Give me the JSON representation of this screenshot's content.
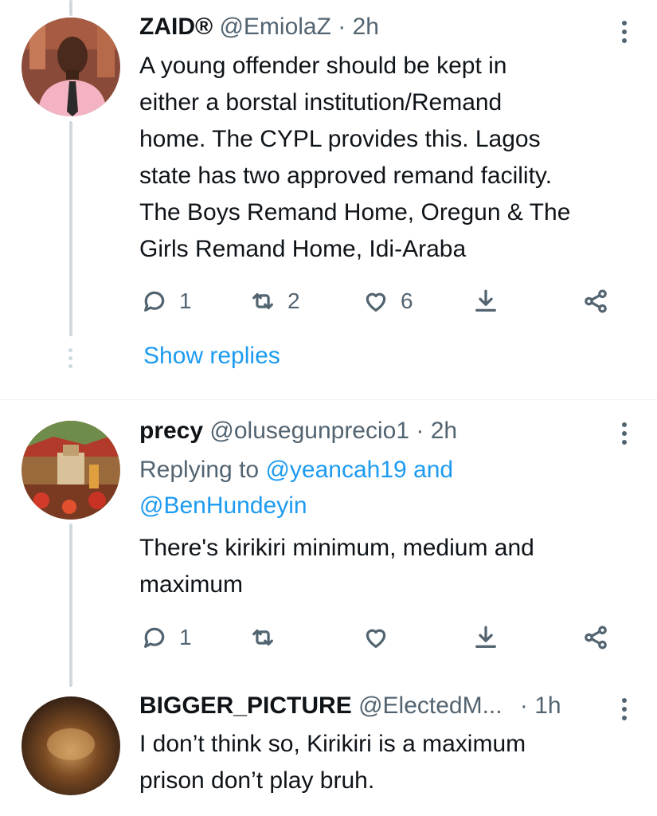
{
  "tweets": [
    {
      "name": "ZAID®",
      "handle": "@EmiolaZ",
      "time": "· 2h",
      "text_lines": [
        "A young offender should be kept in",
        "either a borstal institution/Remand",
        "home. The CYPL provides this. Lagos",
        "state has two approved remand facility.",
        "The Boys Remand Home, Oregun & The",
        "Girls Remand Home, Idi-Araba"
      ],
      "replies": "1",
      "retweets": "2",
      "likes": "6",
      "show_replies": "Show replies",
      "avatar_icon": "person-photo"
    },
    {
      "name": "precy",
      "handle": "@olusegunprecio1",
      "time": "· 2h",
      "replying_prefix": "Replying to",
      "replying_user1": "@yeancah19",
      "replying_and": "and",
      "replying_user2": "@BenHundeyin",
      "text_lines": [
        "There's kirikiri minimum, medium and",
        "maximum"
      ],
      "replies": "1",
      "retweets": "",
      "likes": "",
      "avatar_icon": "garden-photo"
    },
    {
      "name": "BIGGER_PICTURE",
      "handle": "@ElectedM...",
      "time": "· 1h",
      "text_lines": [
        "I don’t think so, Kirikiri is a maximum",
        "prison don’t play bruh."
      ],
      "avatar_icon": "blurred-photo"
    }
  ],
  "colors": {
    "accent": "#1d9bf0",
    "secondary_text": "#536471",
    "thread_line": "#cfd9de"
  }
}
